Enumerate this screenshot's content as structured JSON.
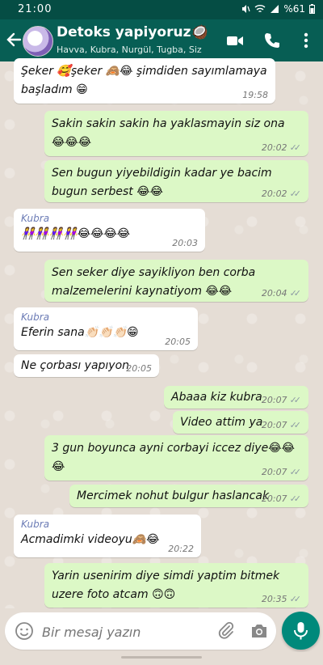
{
  "status_bar": {
    "time": "21:00",
    "battery": "%61"
  },
  "header": {
    "title": "Detoks yapiyoruz🥥🍸...",
    "subtitle": "Havva, Kubra, Nurgül, Tugba, Siz"
  },
  "messages": [
    {
      "dir": "in",
      "sender": "",
      "text": "Şeker 🥰şeker 🙈😂 şimdiden sayımlamaya başladım 😁",
      "time": "19:58"
    },
    {
      "dir": "out",
      "sender": "",
      "text": "Sakin sakin sakin ha yaklasmayin siz ona 😂😂😂",
      "time": "20:02"
    },
    {
      "dir": "out",
      "sender": "",
      "text": "Sen bugun yiyebildigin kadar ye bacim bugun serbest 😂😂",
      "time": "20:02"
    },
    {
      "dir": "in",
      "sender": "Kubra",
      "text": "👭👭👭👭😂😂😂😂",
      "time": "20:03"
    },
    {
      "dir": "out",
      "sender": "",
      "text": "Sen seker diye sayikliyon ben corba malzemelerini kaynatiyom 😂😂",
      "time": "20:04"
    },
    {
      "dir": "in",
      "sender": "Kubra",
      "text": "Eferin sana👏🏻👏🏻👏🏻😁",
      "time": "20:05"
    },
    {
      "dir": "in",
      "sender": "",
      "text": "Ne çorbası yapıyon",
      "time": "20:05"
    },
    {
      "dir": "out",
      "sender": "",
      "text": "Abaaa kiz kubra",
      "time": "20:07"
    },
    {
      "dir": "out",
      "sender": "",
      "text": "Video attim ya",
      "time": "20:07"
    },
    {
      "dir": "out",
      "sender": "",
      "text": "3 gun boyunca ayni corbayi iccez diye😂😂😂",
      "time": "20:07"
    },
    {
      "dir": "out",
      "sender": "",
      "text": "Mercimek nohut bulgur haslancak",
      "time": "20:07"
    },
    {
      "dir": "in",
      "sender": "Kubra",
      "text": "Acmadimki videoyu🙈😂",
      "time": "20:22"
    },
    {
      "dir": "out",
      "sender": "",
      "text": "Yarin usenirim diye simdi yaptim bitmek uzere foto atcam 🙃🙃",
      "time": "20:35"
    }
  ],
  "composer": {
    "placeholder": "Bir mesaj yazın"
  },
  "colors": {
    "header": "#075e54",
    "outgoing": "#dcf8c6",
    "incoming": "#ffffff",
    "accent": "#00897b"
  },
  "icons": [
    "back-arrow-icon",
    "video-call-icon",
    "phone-icon",
    "more-vert-icon",
    "emoji-icon",
    "attach-icon",
    "camera-icon",
    "mic-icon"
  ]
}
